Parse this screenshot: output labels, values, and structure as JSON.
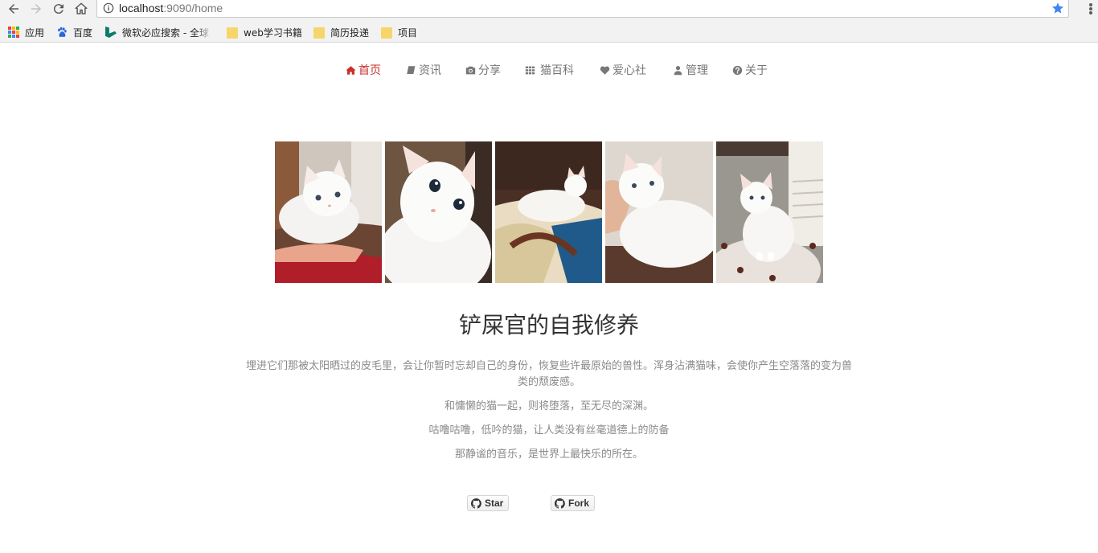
{
  "browser": {
    "url_host": "localhost",
    "url_path": ":9090/home",
    "bookmarks": [
      {
        "label": "应用",
        "icon": "apps-grid-icon"
      },
      {
        "label": "百度",
        "icon": "baidu-paw-icon"
      },
      {
        "label": "微软必应搜索 - 全球",
        "icon": "bing-icon"
      },
      {
        "label": "web学习书籍",
        "icon": "folder-icon"
      },
      {
        "label": "简历投递",
        "icon": "folder-icon"
      },
      {
        "label": "项目",
        "icon": "folder-icon"
      }
    ]
  },
  "nav": {
    "items": [
      {
        "label": "首页",
        "icon": "home-icon",
        "active": true
      },
      {
        "label": "资讯",
        "icon": "book-icon",
        "active": false
      },
      {
        "label": "分享",
        "icon": "camera-icon",
        "active": false
      },
      {
        "label": "猫百科",
        "icon": "grid-icon",
        "active": false
      },
      {
        "label": "爱心社",
        "icon": "heart-icon",
        "active": false
      },
      {
        "label": "管理",
        "icon": "user-icon",
        "active": false
      },
      {
        "label": "关于",
        "icon": "question-circle-icon",
        "active": false
      }
    ],
    "active_color": "#c9302c"
  },
  "main": {
    "title": "铲屎官的自我修养",
    "paragraphs": [
      "埋进它们那被太阳晒过的皮毛里，会让你暂时忘却自己的身份，恢复些许最原始的兽性。浑身沾满猫味，会使你产生空落落的变为兽类的颓废感。",
      "和慵懒的猫一起，则将堕落，至无尽的深渊。",
      "咕噜咕噜，低吟的猫，让人类没有丝毫道德上的防备",
      "那静谧的音乐，是世界上最快乐的所在。"
    ],
    "buttons": {
      "star": "Star",
      "fork": "Fork"
    }
  }
}
